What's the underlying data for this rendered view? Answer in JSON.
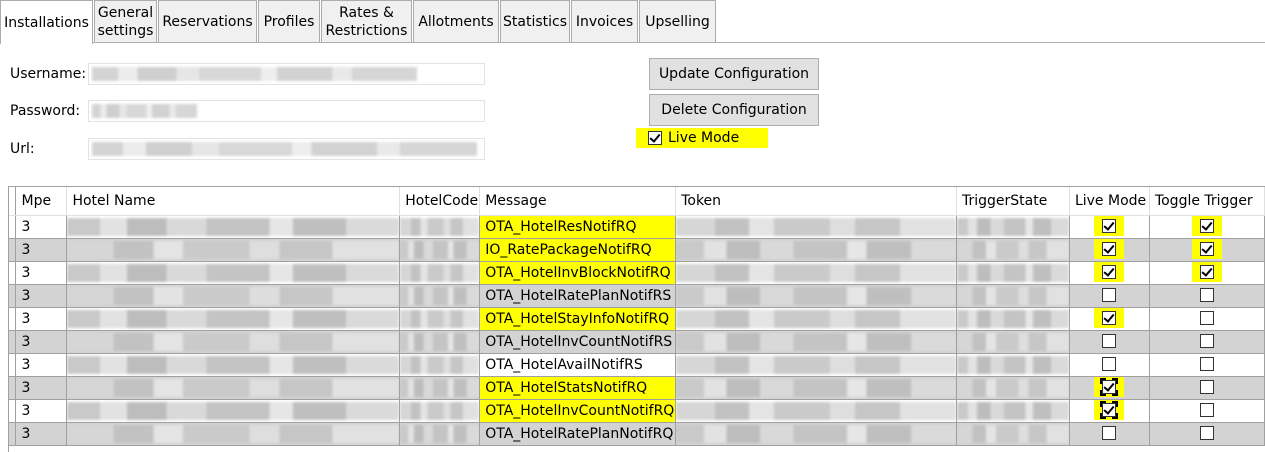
{
  "tabs": [
    {
      "label": "Installations",
      "active": true
    },
    {
      "label": "General\nsettings"
    },
    {
      "label": "Reservations"
    },
    {
      "label": "Profiles"
    },
    {
      "label": "Rates &\nRestrictions"
    },
    {
      "label": "Allotments"
    },
    {
      "label": "Statistics"
    },
    {
      "label": "Invoices"
    },
    {
      "label": "Upselling"
    }
  ],
  "form": {
    "username_label": "Username:",
    "password_label": "Password:",
    "url_label": "Url:",
    "update_button": "Update Configuration",
    "delete_button": "Delete Configuration",
    "live_mode_label": "Live Mode",
    "live_mode_checked": true
  },
  "grid": {
    "columns": [
      "Mpe",
      "Hotel Name",
      "HotelCode",
      "Message",
      "Token",
      "TriggerState",
      "Live Mode",
      "Toggle Trigger"
    ],
    "sorted_column": "TriggerState",
    "rows": [
      {
        "mpe": "3",
        "message": "OTA_HotelResNotifRQ",
        "message_hl": true,
        "live_mode": true,
        "live_hl": true,
        "toggle": true,
        "toggle_hl": true
      },
      {
        "mpe": "3",
        "message": "IO_RatePackageNotifRQ",
        "message_hl": true,
        "live_mode": true,
        "live_hl": true,
        "toggle": true,
        "toggle_hl": true
      },
      {
        "mpe": "3",
        "message": "OTA_HotelInvBlockNotifRQ",
        "message_hl": true,
        "live_mode": true,
        "live_hl": true,
        "toggle": true,
        "toggle_hl": true
      },
      {
        "mpe": "3",
        "message": "OTA_HotelRatePlanNotifRS",
        "message_hl": false,
        "live_mode": false,
        "live_hl": false,
        "toggle": false,
        "toggle_hl": false
      },
      {
        "mpe": "3",
        "message": "OTA_HotelStayInfoNotifRQ",
        "message_hl": true,
        "live_mode": true,
        "live_hl": true,
        "toggle": false,
        "toggle_hl": false
      },
      {
        "mpe": "3",
        "message": "OTA_HotelInvCountNotifRS",
        "message_hl": false,
        "live_mode": false,
        "live_hl": false,
        "toggle": false,
        "toggle_hl": false
      },
      {
        "mpe": "3",
        "message": "OTA_HotelAvailNotifRS",
        "message_hl": false,
        "live_mode": false,
        "live_hl": false,
        "toggle": false,
        "toggle_hl": false
      },
      {
        "mpe": "3",
        "message": "OTA_HotelStatsNotifRQ",
        "message_hl": true,
        "live_mode": true,
        "live_hl": true,
        "toggle": false,
        "toggle_hl": false
      },
      {
        "mpe": "3",
        "message": "OTA_HotelInvCountNotifRQ",
        "message_hl": true,
        "live_mode": true,
        "live_hl": true,
        "toggle": false,
        "toggle_hl": false
      },
      {
        "mpe": "3",
        "message": "OTA_HotelRatePlanNotifRQ",
        "message_hl": false,
        "live_mode": false,
        "live_hl": false,
        "toggle": false,
        "toggle_hl": false
      }
    ]
  },
  "colors": {
    "highlight": "#ffff00",
    "alt_row": "#d3d3d3",
    "button_bg": "#e1e1e1"
  }
}
